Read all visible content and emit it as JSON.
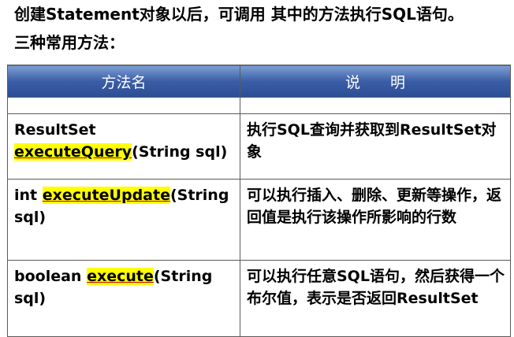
{
  "intro": "创建Statement对象以后，可调用 其中的方法执行SQL语句。",
  "subtitle": "三种常用方法：",
  "table": {
    "headers": [
      "方法名",
      "说　　明"
    ],
    "rows": [
      {
        "pre": "ResultSet",
        "method": "executeQuery",
        "post": "(String sql)",
        "desc": "执行SQL查询并获取到ResultSet对象"
      },
      {
        "pre": "int ",
        "method": "executeUpdate",
        "post": "(String sql)",
        "desc": "可以执行插入、删除、更新等操作，返回值是执行该操作所影响的行数"
      },
      {
        "pre": "boolean ",
        "method": "execute",
        "post": "(String sql)",
        "desc": "可以执行任意SQL语句，然后获得一个布尔值，表示是否返回ResultSet"
      }
    ]
  }
}
